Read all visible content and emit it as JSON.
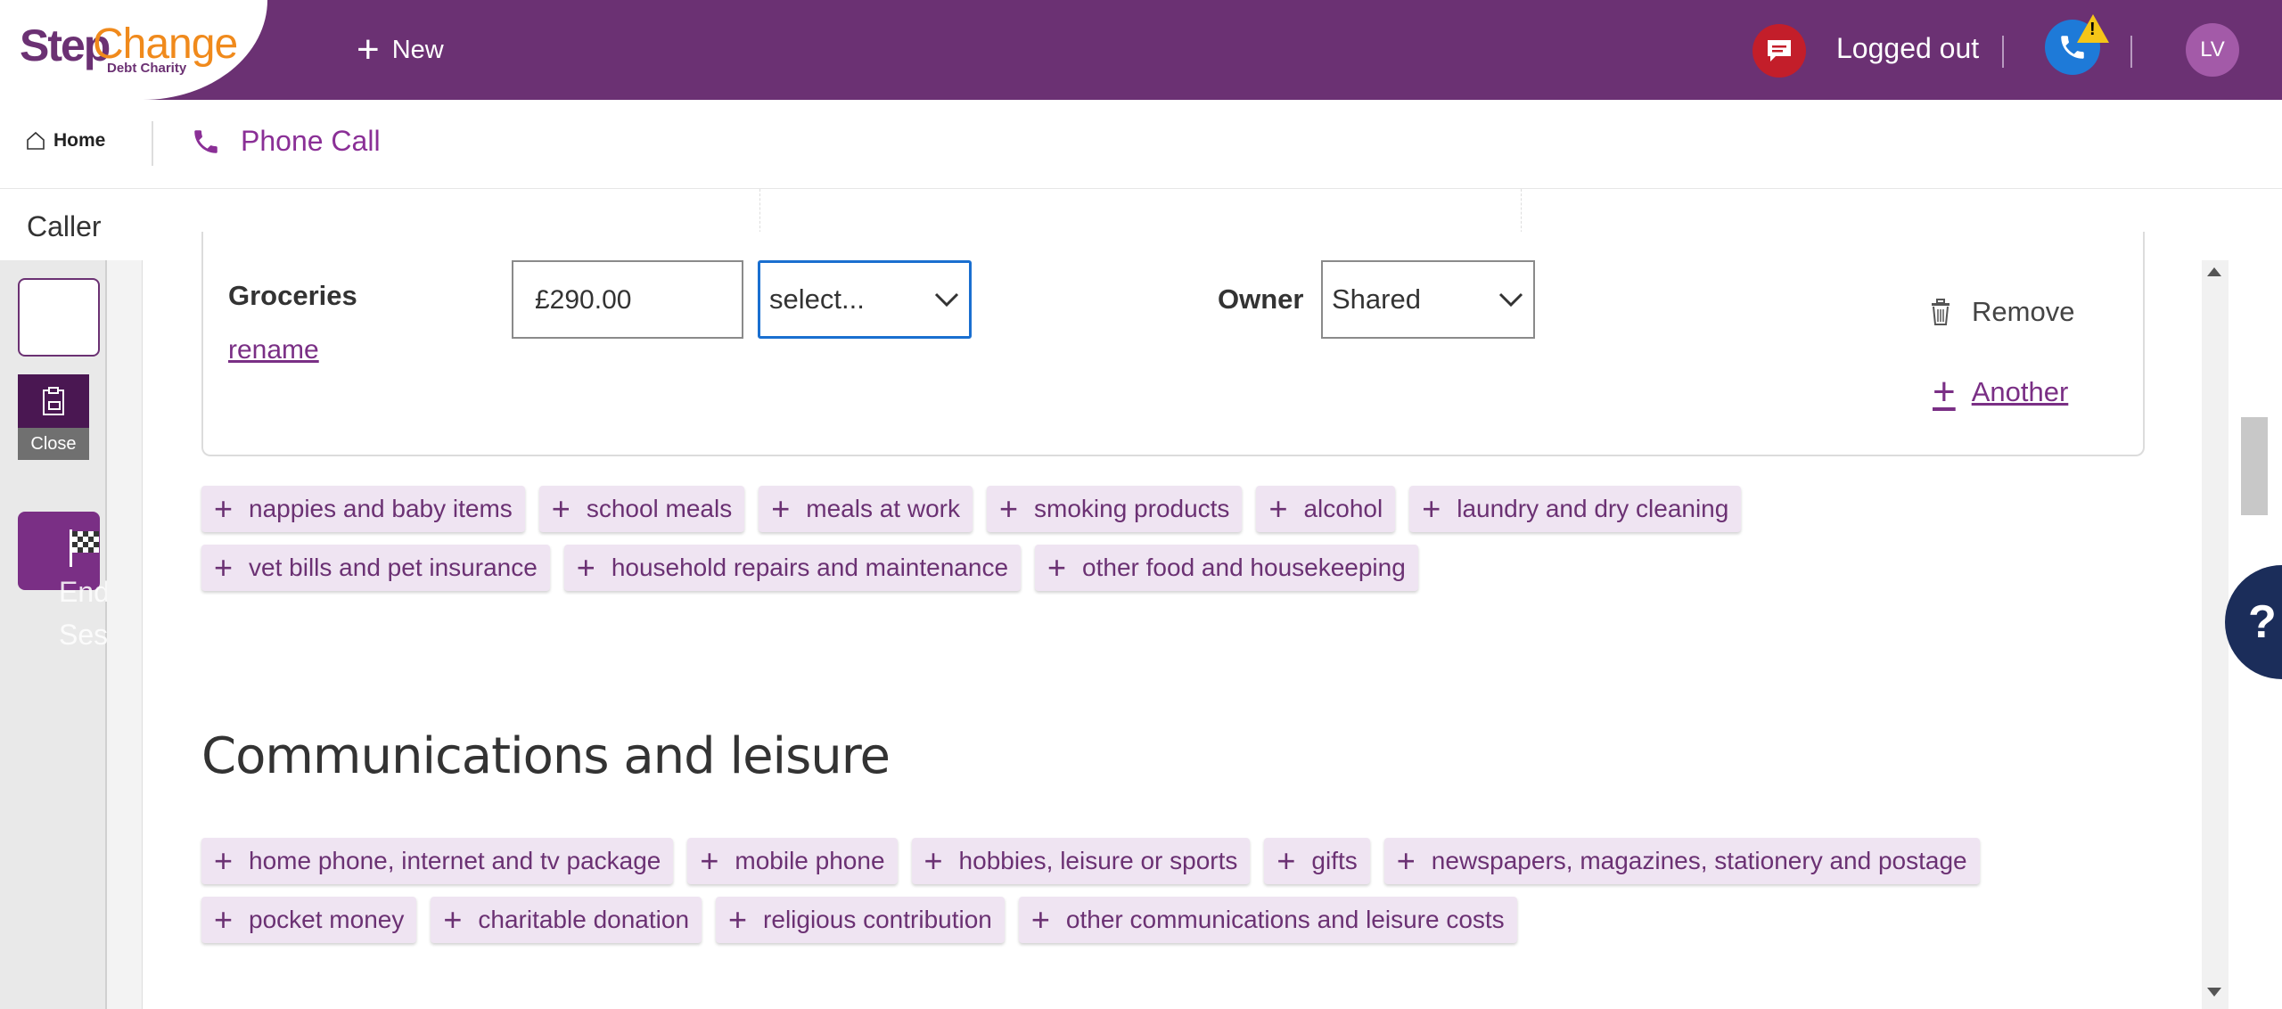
{
  "header": {
    "logo_step": "Step",
    "logo_change": "Change",
    "logo_sub": "Debt Charity",
    "new_label": "New",
    "status_text": "Logged out",
    "avatar_initials": "LV"
  },
  "subnav": {
    "home_label": "Home",
    "activity_label": "Phone Call"
  },
  "caller_label": "Caller",
  "rail": {
    "close_label": "Close",
    "end_line1": "End",
    "end_line2": "Session"
  },
  "expense_item": {
    "name": "Groceries",
    "rename_label": "rename",
    "amount": "£290.00",
    "frequency": "select...",
    "owner_label": "Owner",
    "owner_value": "Shared",
    "remove_label": "Remove",
    "another_label": "Another"
  },
  "food_chips_row1": [
    "nappies and baby items",
    "school meals",
    "meals at work",
    "smoking products",
    "alcohol",
    "laundry and dry cleaning"
  ],
  "food_chips_row2": [
    "vet bills and pet insurance",
    "household repairs and maintenance",
    "other food and housekeeping"
  ],
  "section": {
    "title": "Communications and leisure"
  },
  "comm_chips_row1": [
    "home phone, internet and tv package",
    "mobile phone",
    "hobbies, leisure or sports",
    "gifts",
    "newspapers, magazines, stationery and postage"
  ],
  "comm_chips_row2": [
    "pocket money",
    "charitable donation",
    "religious contribution",
    "other communications and leisure costs"
  ],
  "help_label": "?",
  "colors": {
    "brand_purple": "#6b3173",
    "accent_orange": "#f08a1c",
    "chip_bg": "#efe4f2",
    "focus_blue": "#1a6fd0",
    "alert_red": "#c31e2a"
  }
}
